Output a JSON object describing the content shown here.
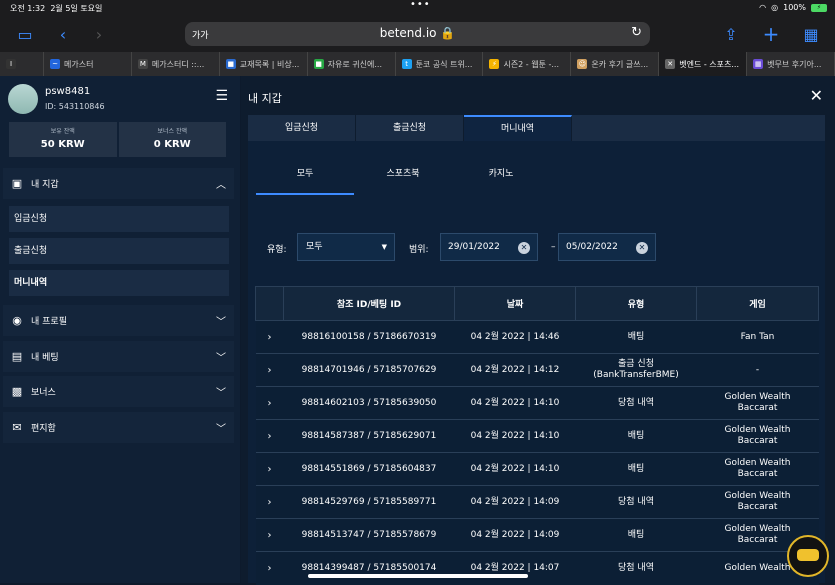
{
  "status": {
    "time": "오전 1:32",
    "date": "2월 5일 토요일",
    "dots": "•••",
    "battery": "100%"
  },
  "browser": {
    "aa": "가가",
    "url": "betend.io 🔒",
    "reload_icon": "reload-icon"
  },
  "tabs": [
    {
      "label": "",
      "icon": "I"
    },
    {
      "label": "메가스터",
      "icon": "~"
    },
    {
      "label": "메가스터디 ::...",
      "icon": "M"
    },
    {
      "label": "교재목록 | 비상...",
      "icon": "■"
    },
    {
      "label": "자유로 귀신에...",
      "icon": "■"
    },
    {
      "label": "툰코 공식 트위...",
      "icon": "t"
    },
    {
      "label": "시즌2 - 웹툰 -...",
      "icon": "⚡"
    },
    {
      "label": "온카 후기 글쓰...",
      "icon": "☺"
    },
    {
      "label": "벳엔드 - 스포츠...",
      "icon": "✕"
    },
    {
      "label": "벳무브 후기아...",
      "icon": "▦"
    }
  ],
  "user": {
    "name": "psw8481",
    "id": "ID: 543110846"
  },
  "balances": [
    {
      "title": "보유 잔액",
      "value": "50 KRW"
    },
    {
      "title": "보너스 잔액",
      "value": "0 KRW"
    }
  ],
  "sidebar": {
    "wallet": "내 지갑",
    "sub": [
      "입금신청",
      "출금신청",
      "머니내역"
    ],
    "profile": "내 프로필",
    "betting": "내 베팅",
    "bonus": "보너스",
    "mail": "편지함"
  },
  "panel": {
    "title": "내 지갑",
    "close": "✕",
    "tabs": [
      "입금신청",
      "출금신청",
      "머니내역"
    ],
    "subtabs": [
      "모두",
      "스포츠북",
      "카지노"
    ],
    "type_label": "유형:",
    "type_value": "모두",
    "range_label": "범위:",
    "date_from": "29/01/2022",
    "date_to": "05/02/2022",
    "dash": "–"
  },
  "table": {
    "headers": [
      "",
      "참조 ID/베팅 ID",
      "날짜",
      "유형",
      "게임"
    ],
    "rows": [
      [
        "98816100158 / 57186670319",
        "04 2월 2022 | 14:46",
        "배팅",
        "Fan Tan"
      ],
      [
        "98814701946 / 57185707629",
        "04 2월 2022 | 14:12",
        "출금 신청\n(BankTransferBME)",
        "-"
      ],
      [
        "98814602103 / 57185639050",
        "04 2월 2022 | 14:10",
        "당첨 내역",
        "Golden Wealth\nBaccarat"
      ],
      [
        "98814587387 / 57185629071",
        "04 2월 2022 | 14:10",
        "배팅",
        "Golden Wealth\nBaccarat"
      ],
      [
        "98814551869 / 57185604837",
        "04 2월 2022 | 14:10",
        "배팅",
        "Golden Wealth\nBaccarat"
      ],
      [
        "98814529769 / 57185589771",
        "04 2월 2022 | 14:09",
        "당첨 내역",
        "Golden Wealth\nBaccarat"
      ],
      [
        "98814513747 / 57185578679",
        "04 2월 2022 | 14:09",
        "배팅",
        "Golden Wealth\nBaccarat"
      ],
      [
        "98814399487 / 57185500174",
        "04 2월 2022 | 14:07",
        "당첨 내역",
        "Golden Wealth"
      ]
    ]
  }
}
